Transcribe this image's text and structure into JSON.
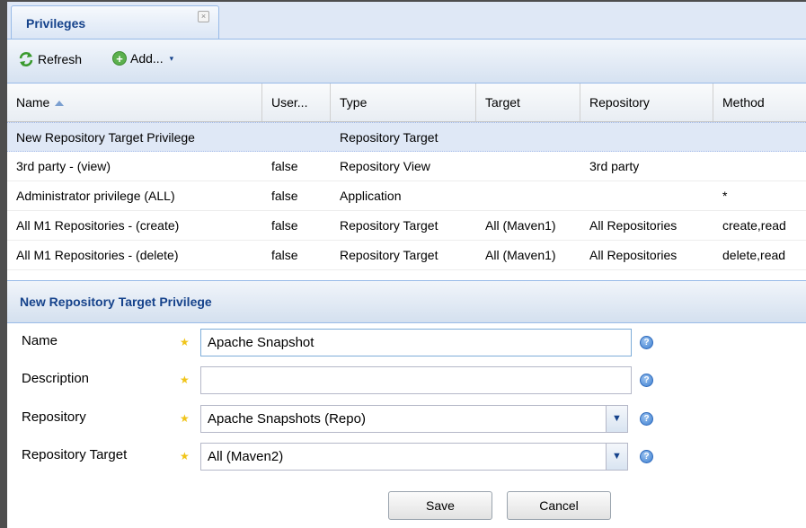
{
  "tab": {
    "title": "Privileges",
    "close_glyph": "×"
  },
  "toolbar": {
    "refresh_label": "Refresh",
    "add_label": "Add...",
    "add_glyph": "+",
    "dropdown_glyph": "▾"
  },
  "grid": {
    "columns": [
      "Name",
      "User...",
      "Type",
      "Target",
      "Repository",
      "Method"
    ],
    "rows": [
      [
        "New Repository Target Privilege",
        "",
        "Repository Target",
        "",
        "",
        ""
      ],
      [
        "3rd party - (view)",
        "false",
        "Repository View",
        "",
        "3rd party",
        ""
      ],
      [
        "Administrator privilege (ALL)",
        "false",
        "Application",
        "",
        "",
        "*"
      ],
      [
        "All M1 Repositories - (create)",
        "false",
        "Repository Target",
        "All (Maven1)",
        "All Repositories",
        "create,read"
      ],
      [
        "All M1 Repositories - (delete)",
        "false",
        "Repository Target",
        "All (Maven1)",
        "All Repositories",
        "delete,read"
      ]
    ]
  },
  "form": {
    "title": "New Repository Target Privilege",
    "required_glyph": "★",
    "help_glyph": "?",
    "combo_glyph": "▼",
    "fields": {
      "name": {
        "label": "Name",
        "value": "Apache Snapshot"
      },
      "description": {
        "label": "Description",
        "value": ""
      },
      "repository": {
        "label": "Repository",
        "value": "Apache Snapshots (Repo)"
      },
      "repository_target": {
        "label": "Repository Target",
        "value": "All (Maven2)"
      }
    },
    "save_label": "Save",
    "cancel_label": "Cancel"
  },
  "colors": {
    "accent": "#15428b",
    "selected_row": "#dfe8f6",
    "required_star": "#f0c419",
    "add_green": "#5bb04d"
  }
}
